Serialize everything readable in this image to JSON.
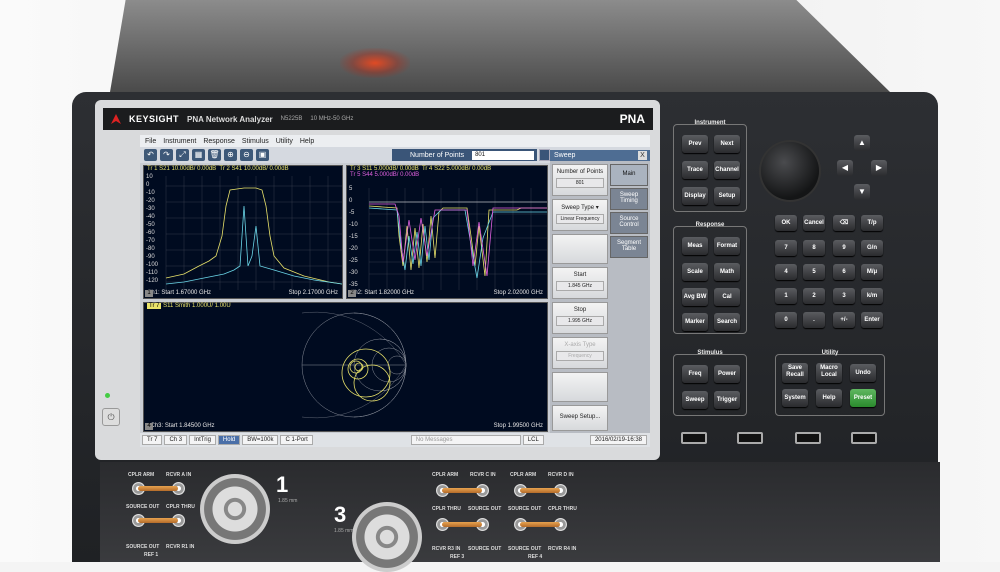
{
  "brand": {
    "name": "KEYSIGHT",
    "model": "PNA Network Analyzer",
    "model_number": "N5225B",
    "range": "10 MHz-50 GHz",
    "pna": "PNA"
  },
  "menu": [
    "File",
    "Instrument",
    "Response",
    "Stimulus",
    "Utility",
    "Help"
  ],
  "toolbar": {
    "icons": [
      "undo-icon",
      "redo-icon",
      "zoom-icon",
      "table-icon",
      "delete-icon",
      "zoom-in-icon",
      "zoom-out-icon",
      "window-icon"
    ],
    "num_points_label": "Number of Points",
    "num_points_value": "801"
  },
  "win1": {
    "traces": [
      "Tr 1  S21 10.00dB/  0.00dB",
      "Tr 2  S41 10.00dB/  0.00dB"
    ],
    "ylabels": [
      "10",
      "0",
      "-10",
      "-20",
      "-30",
      "-40",
      "-50",
      "-60",
      "-70",
      "-80",
      "-90",
      "-100",
      "-110",
      "-120"
    ],
    "footer_left": "Ch1:  Start  1.67000 GHz",
    "footer_right": "Stop  2.17000 GHz",
    "num": "1"
  },
  "win2": {
    "traces": [
      "Tr 3  S11 5.000dB/  0.00dB",
      "Tr 4  S22 5.000dB/  0.00dB",
      "Tr 5  S44 5.000dB/  0.00dB"
    ],
    "ylabels": [
      "5",
      "0",
      "-5",
      "-10",
      "-15",
      "-20",
      "-25",
      "-30",
      "-35"
    ],
    "footer_left": "Ch2:  Start  1.82000 GHz",
    "footer_right": "Stop  2.02000 GHz",
    "num": "2"
  },
  "win4": {
    "trace_tag": "Tr 7",
    "trace": "S11 Smith 1.000U/  1.00U",
    "footer_left": ">Ch3:  Start  1.84500 GHz",
    "footer_right": "Stop  1.99500 GHz",
    "num": "4"
  },
  "sweep": {
    "title": "Sweep",
    "close": "X",
    "buttons": [
      {
        "label": "Number of Points",
        "value": "801"
      },
      {
        "label": "Sweep Type",
        "value": "Linear Frequency"
      },
      {
        "label": "",
        "value": ""
      },
      {
        "label": "Start",
        "value": "1.845 GHz"
      },
      {
        "label": "Stop",
        "value": "1.995 GHz"
      },
      {
        "label": "X-axis Type",
        "value": "Frequency"
      },
      {
        "label": "",
        "value": ""
      },
      {
        "label": "Sweep Setup...",
        "value": ""
      }
    ],
    "tabs": [
      "Main",
      "Sweep Timing",
      "Source Control",
      "Segment Table"
    ]
  },
  "status": {
    "items": [
      "Tr 7",
      "Ch 3",
      "IntTrig",
      "Hold",
      "BW=100k",
      "C  1-Port"
    ],
    "messages": "No Messages",
    "lcl": "LCL",
    "datetime": "2016/02/19-16:38"
  },
  "instrument": {
    "label": "Instrument",
    "keys": [
      "Prev",
      "Next",
      "Trace",
      "Channel",
      "Display",
      "Setup"
    ]
  },
  "response": {
    "label": "Response",
    "keys": [
      "Meas",
      "Format",
      "Scale",
      "Math",
      "Avg BW",
      "Cal",
      "Marker",
      "Search"
    ]
  },
  "stimulus": {
    "label": "Stimulus",
    "keys": [
      "Freq",
      "Power",
      "Sweep",
      "Trigger"
    ]
  },
  "utility": {
    "label": "Utility",
    "keys": [
      "Save Recall",
      "Macro Local",
      "Undo",
      "System",
      "Help",
      "Preset"
    ]
  },
  "numpad": [
    "OK",
    "Cancel",
    "⌫",
    "T/p",
    "7",
    "8",
    "9",
    "G/n",
    "4",
    "5",
    "6",
    "M/μ",
    "1",
    "2",
    "3",
    "k/m",
    "0",
    ".",
    "+/-",
    "Enter"
  ],
  "ports": {
    "p1": "1",
    "p3": "3",
    "p1_sub": "1.85 mm",
    "p3_sub": "1.85 mm",
    "labels": [
      "CPLR ARM",
      "RCVR A IN",
      "SOURCE OUT",
      "CPLR THRU",
      "SOURCE OUT",
      "RCVR R1 IN",
      "REF 1",
      "CPLR ARM",
      "RCVR C IN",
      "CPLR ARM",
      "RCVR D IN",
      "CPLR THRU",
      "SOURCE OUT",
      "SOURCE OUT",
      "CPLR THRU",
      "RCVR R3 IN",
      "SOURCE OUT",
      "SOURCE OUT",
      "RCVR R4 IN",
      "REF 3",
      "REF 4"
    ]
  }
}
